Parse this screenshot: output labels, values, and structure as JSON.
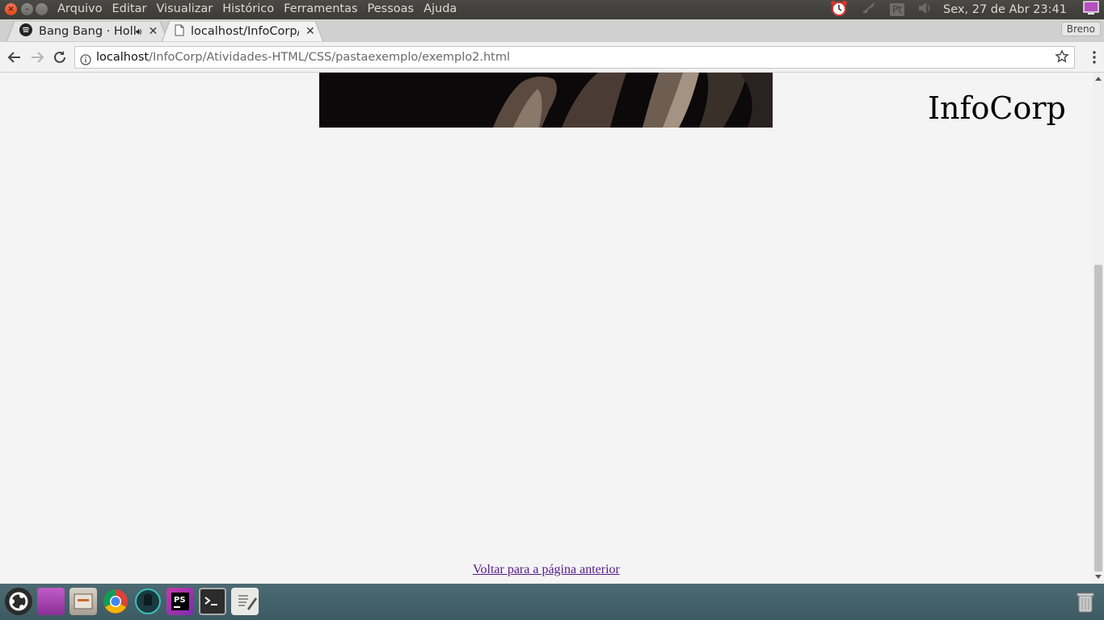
{
  "menubar": {
    "items": [
      "Arquivo",
      "Editar",
      "Visualizar",
      "Histórico",
      "Ferramentas",
      "Pessoas",
      "Ajuda"
    ],
    "keyboard_indicator": "Pt",
    "clock": "Sex, 27 de Abr 23:41"
  },
  "tabs": [
    {
      "title": "Bang Bang · Holly",
      "icon": "spotify-icon",
      "audio": true,
      "active": false
    },
    {
      "title": "localhost/InfoCorp/",
      "icon": "page-icon",
      "audio": false,
      "active": true
    }
  ],
  "profile": {
    "name": "Breno"
  },
  "address": {
    "host": "localhost",
    "path": "/InfoCorp/Atividades-HTML/CSS/pastaexemplo/exemplo2.html"
  },
  "page": {
    "brand": "InfoCorp",
    "back_link": "Voltar para a página anterior"
  },
  "dock": {
    "apps": [
      "ubuntu-launcher-icon",
      "app-store-icon",
      "files-icon",
      "chrome-icon",
      "gitkraken-icon",
      "phpstorm-icon",
      "terminal-icon",
      "text-editor-icon",
      "trash-icon"
    ]
  },
  "colors": {
    "link_visited": "#551a8b",
    "page_bg": "#f4f4f4",
    "menubar_bg": "#3c3b37"
  }
}
